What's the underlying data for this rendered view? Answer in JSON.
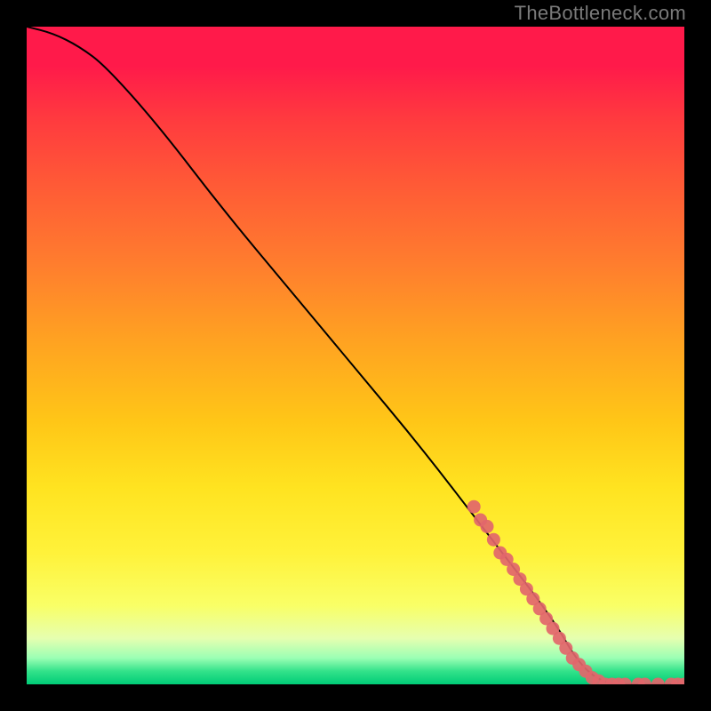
{
  "watermark": "TheBottleneck.com",
  "chart_data": {
    "type": "line",
    "title": "",
    "xlabel": "",
    "ylabel": "",
    "xlim": [
      0,
      100
    ],
    "ylim": [
      0,
      100
    ],
    "gradient_stops": [
      {
        "pct": 0,
        "color": "#ff1a4a"
      },
      {
        "pct": 6,
        "color": "#ff1a4a"
      },
      {
        "pct": 14,
        "color": "#ff3a3f"
      },
      {
        "pct": 24,
        "color": "#ff5a36"
      },
      {
        "pct": 36,
        "color": "#ff7d2e"
      },
      {
        "pct": 48,
        "color": "#ffa321"
      },
      {
        "pct": 60,
        "color": "#ffc617"
      },
      {
        "pct": 70,
        "color": "#ffe320"
      },
      {
        "pct": 80,
        "color": "#fff23a"
      },
      {
        "pct": 88,
        "color": "#f9ff66"
      },
      {
        "pct": 93,
        "color": "#e6ffb0"
      },
      {
        "pct": 96,
        "color": "#9bffb4"
      },
      {
        "pct": 98,
        "color": "#33e28a"
      },
      {
        "pct": 100,
        "color": "#00cc77"
      }
    ],
    "series": [
      {
        "name": "bottleneck-curve",
        "x": [
          0,
          4,
          8,
          12,
          20,
          30,
          40,
          50,
          60,
          70,
          80,
          84,
          88,
          92,
          96,
          100
        ],
        "y": [
          100,
          99,
          97,
          94,
          85,
          72,
          60,
          48,
          36,
          23,
          10,
          3,
          0,
          0,
          0,
          0
        ]
      }
    ],
    "highlight_points": [
      {
        "x": 68,
        "y": 27
      },
      {
        "x": 69,
        "y": 25
      },
      {
        "x": 70,
        "y": 24
      },
      {
        "x": 71,
        "y": 22
      },
      {
        "x": 72,
        "y": 20
      },
      {
        "x": 73,
        "y": 19
      },
      {
        "x": 74,
        "y": 17.5
      },
      {
        "x": 75,
        "y": 16
      },
      {
        "x": 76,
        "y": 14.5
      },
      {
        "x": 77,
        "y": 13
      },
      {
        "x": 78,
        "y": 11.5
      },
      {
        "x": 79,
        "y": 10
      },
      {
        "x": 80,
        "y": 8.5
      },
      {
        "x": 81,
        "y": 7
      },
      {
        "x": 82,
        "y": 5.5
      },
      {
        "x": 83,
        "y": 4
      },
      {
        "x": 84,
        "y": 3
      },
      {
        "x": 85,
        "y": 2
      },
      {
        "x": 86,
        "y": 1
      },
      {
        "x": 87,
        "y": 0.5
      },
      {
        "x": 88,
        "y": 0
      },
      {
        "x": 89,
        "y": 0
      },
      {
        "x": 90,
        "y": 0
      },
      {
        "x": 91,
        "y": 0
      },
      {
        "x": 93,
        "y": 0
      },
      {
        "x": 94,
        "y": 0
      },
      {
        "x": 96,
        "y": 0
      },
      {
        "x": 98,
        "y": 0
      },
      {
        "x": 99,
        "y": 0
      },
      {
        "x": 100,
        "y": 0
      }
    ],
    "highlight_color": "#e2666b",
    "curve_color": "#000000"
  }
}
